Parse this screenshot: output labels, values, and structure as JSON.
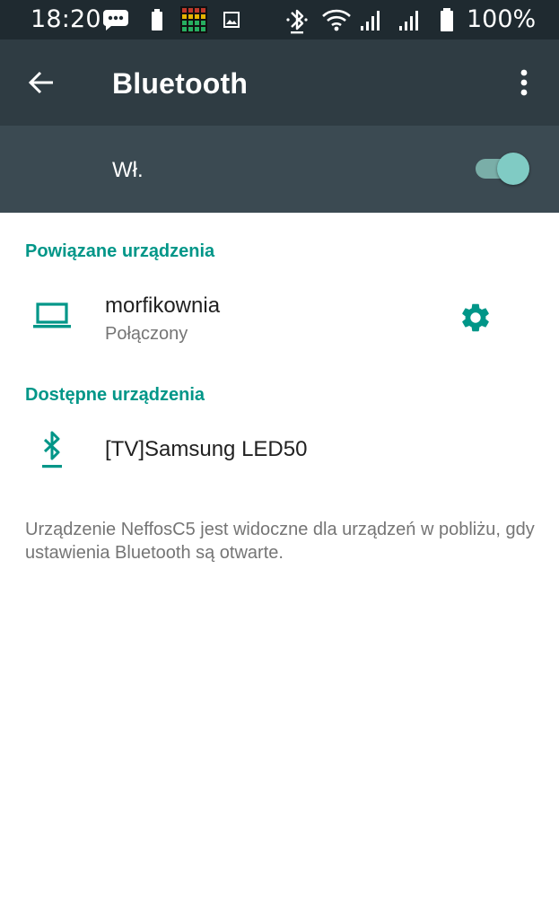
{
  "status_bar": {
    "time": "18:20",
    "battery_percent": "100%",
    "icons": [
      "chat-notification-icon",
      "battery-small-icon",
      "equalizer-app-icon",
      "image-icon",
      "bluetooth-icon",
      "wifi-icon",
      "signal-1-icon",
      "signal-2-icon",
      "battery-icon"
    ]
  },
  "toolbar": {
    "title": "Bluetooth",
    "back_icon": "arrow-back-icon",
    "menu_icon": "more-vert-icon"
  },
  "switch_bar": {
    "label": "Wł.",
    "checked": true
  },
  "paired_section": {
    "header": "Powiązane urządzenia",
    "devices": [
      {
        "name": "morfikownia",
        "status": "Połączony",
        "icon": "laptop-icon",
        "settings_icon": "gear-icon"
      }
    ]
  },
  "available_section": {
    "header": "Dostępne urządzenia",
    "devices": [
      {
        "name": "[TV]Samsung LED50",
        "icon": "bluetooth-searching-icon"
      }
    ]
  },
  "footer": {
    "text": "Urządzenie NeffosC5 jest widoczne dla urządzeń w pobliżu, gdy ustawienia Bluetooth są otwarte."
  },
  "colors": {
    "accent": "#009688",
    "status_bar": "#1f2a30",
    "toolbar": "#2f3c43",
    "switch_bar": "#3b4a52"
  }
}
